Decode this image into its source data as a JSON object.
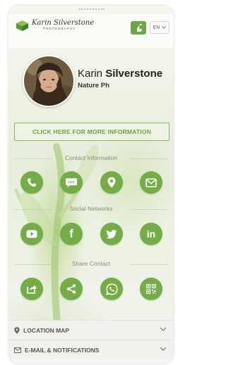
{
  "header": {
    "logo_name": "Karin Silverstone",
    "logo_sub": "PHOTOGRAPHY",
    "language": "EN"
  },
  "profile": {
    "first_name": "Karin",
    "last_name": "Silverstone",
    "title": "Nature Ph"
  },
  "more_info_label": "CLICK HERE FOR MORE INFORMATION",
  "contact": {
    "label": "Contact Information",
    "icons": [
      "phone-icon",
      "sms-icon",
      "location-pin-icon",
      "email-icon"
    ]
  },
  "social": {
    "label": "Social Networks",
    "icons": [
      "youtube-icon",
      "facebook-icon",
      "twitter-icon",
      "linkedin-icon"
    ],
    "facebook": "f",
    "linkedin": "in"
  },
  "share": {
    "label": "Share Contact",
    "icons": [
      "share-export-icon",
      "share-nodes-icon",
      "whatsapp-icon",
      "qr-code-icon"
    ]
  },
  "sms_text": "SMS",
  "accordion": {
    "location": "LOCATION MAP",
    "email": "E-MAIL & NOTIFICATIONS"
  },
  "colors": {
    "accent": "#74ad46",
    "background": "#f4f6ef"
  }
}
